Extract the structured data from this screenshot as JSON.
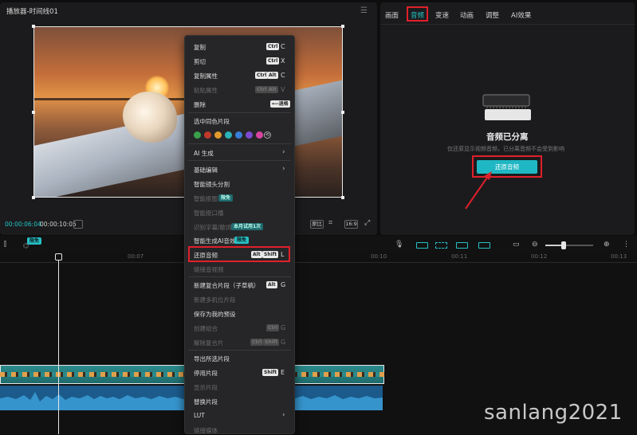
{
  "player": {
    "title": "播放器-时间线01",
    "time_current": "00:00:06:04",
    "time_total": "00:00:10:05",
    "ratio_label": "原比",
    "aspect_label": "16:9"
  },
  "inspector": {
    "tabs": [
      "画面",
      "音频",
      "变速",
      "动画",
      "调整",
      "AI效果"
    ],
    "active_tab": "音频",
    "audio_title": "音频已分离",
    "audio_desc": "仅还原显示视频音频，已分离音频不会受到影响",
    "restore_button": "还原音频"
  },
  "toolbar": {
    "badge": "限免"
  },
  "ruler": {
    "ticks": [
      "00:07",
      "00:10",
      "00:11",
      "00:12",
      "00:13"
    ]
  },
  "context_menu": {
    "items": {
      "copy": {
        "label": "复制",
        "keys": [
          "Ctrl",
          "C"
        ]
      },
      "cut": {
        "label": "剪切",
        "keys": [
          "Ctrl",
          "X"
        ]
      },
      "copy_attr": {
        "label": "复制属性",
        "keys": [
          "Ctrl",
          "Alt",
          "C"
        ]
      },
      "paste_attr": {
        "label": "粘贴属性",
        "keys": [
          "Ctrl",
          "Alt",
          "V"
        ]
      },
      "delete": {
        "label": "删除",
        "keys": [
          "⟵退格"
        ]
      },
      "select_same_color": {
        "label": "选中同色片段"
      },
      "ai_gen": {
        "label": "AI 生成"
      },
      "basic_edit": {
        "label": "基础编辑"
      },
      "smart_split": {
        "label": "智能镜头分割"
      },
      "smart_cut": {
        "label": "智能抠图",
        "badge": "限免"
      },
      "smart_remove": {
        "label": "智能抠口播"
      },
      "recognize_subtitle": {
        "label": "识别字幕/歌词",
        "badge": "本月试用1次"
      },
      "smart_ai_sfx": {
        "label": "智能生成AI音效",
        "badge": "限免"
      },
      "restore_audio": {
        "label": "还原音频",
        "keys": [
          "Alt",
          "Shift",
          "L"
        ]
      },
      "link_tracks": {
        "label": "链接音视频"
      },
      "new_compound": {
        "label": "新建复合片段（子草稿）",
        "keys": [
          "Alt",
          "G"
        ]
      },
      "new_multicam": {
        "label": "新建多机位片段"
      },
      "save_preset": {
        "label": "保存为我的预设"
      },
      "create_group": {
        "label": "创建组合",
        "keys": [
          "Ctrl",
          "G"
        ]
      },
      "ungroup": {
        "label": "解除复合片",
        "keys": [
          "Ctrl",
          "Shift",
          "G"
        ]
      },
      "export_clip": {
        "label": "导出所选片段"
      },
      "disable_clip": {
        "label": "停用片段",
        "keys": [
          "Shift",
          "E"
        ]
      },
      "reveal_clip": {
        "label": "显示片段"
      },
      "replace_clip": {
        "label": "替换片段"
      },
      "lut": {
        "label": "LUT"
      },
      "link_media": {
        "label": "链接媒体"
      }
    },
    "swatch_colors": [
      "#3aa04a",
      "#c0392b",
      "#e09a2c",
      "#2bb3b8",
      "#3a7ed8",
      "#7c4ad0",
      "#d845a0"
    ]
  },
  "watermark": "sanlang2021"
}
